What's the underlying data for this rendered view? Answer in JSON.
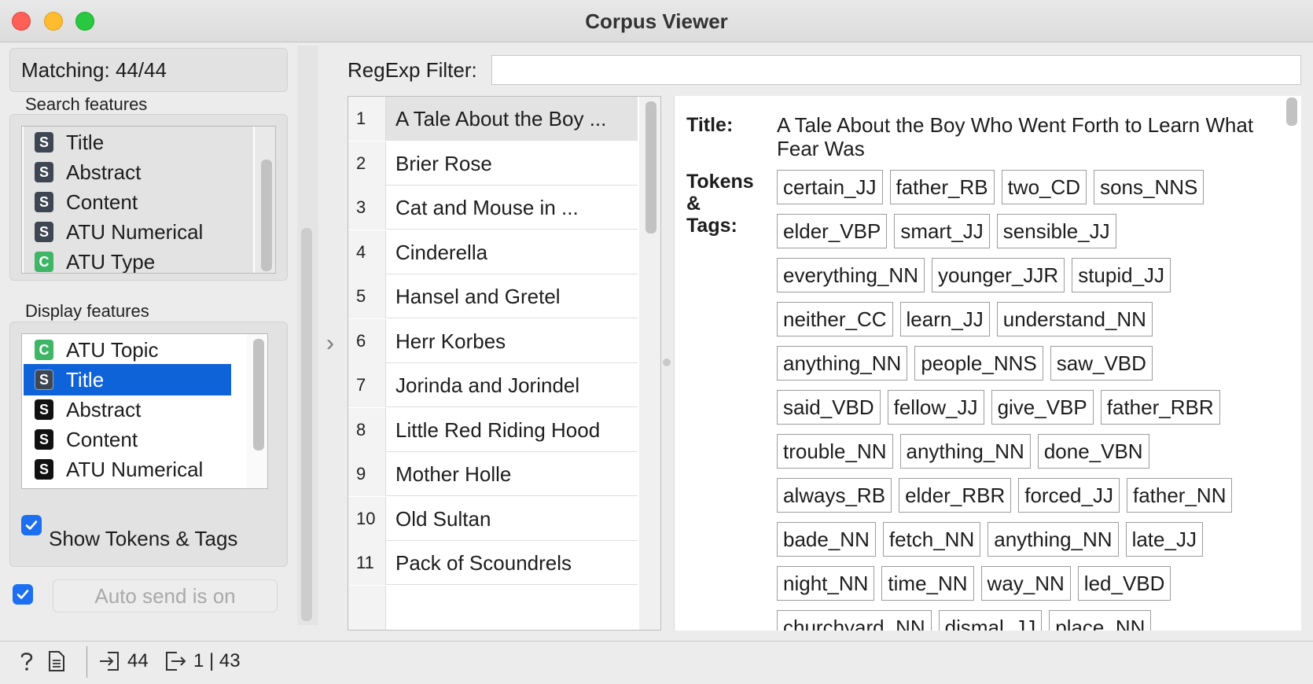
{
  "window": {
    "title": "Corpus Viewer"
  },
  "matching": {
    "label": "Matching: 44/44"
  },
  "search_features": {
    "label": "Search features",
    "items": [
      {
        "badge": "S",
        "label": "Title"
      },
      {
        "badge": "S",
        "label": "Abstract"
      },
      {
        "badge": "S",
        "label": "Content"
      },
      {
        "badge": "S",
        "label": "ATU Numerical"
      },
      {
        "badge": "C",
        "label": "ATU Type"
      }
    ]
  },
  "display_features": {
    "label": "Display features",
    "items": [
      {
        "badge": "C",
        "label": "ATU Topic"
      },
      {
        "badge": "S",
        "label": "Title",
        "selected": true
      },
      {
        "badge": "S",
        "label": "Abstract"
      },
      {
        "badge": "S",
        "label": "Content"
      },
      {
        "badge": "S",
        "label": "ATU Numerical"
      }
    ],
    "show_tokens_label": "Show Tokens & Tags",
    "show_tokens_checked": true
  },
  "auto_send": {
    "label": "Auto send is on",
    "checked": true
  },
  "filter": {
    "label": "RegExp Filter:",
    "value": ""
  },
  "documents": [
    {
      "num": "1",
      "title": "A Tale About the Boy ...",
      "selected": true
    },
    {
      "num": "2",
      "title": "Brier Rose"
    },
    {
      "num": "3",
      "title": "Cat and Mouse in ..."
    },
    {
      "num": "4",
      "title": "Cinderella"
    },
    {
      "num": "5",
      "title": "Hansel and Gretel"
    },
    {
      "num": "6",
      "title": "Herr Korbes"
    },
    {
      "num": "7",
      "title": "Jorinda and Jorindel"
    },
    {
      "num": "8",
      "title": "Little Red Riding Hood"
    },
    {
      "num": "9",
      "title": "Mother Holle"
    },
    {
      "num": "10",
      "title": "Old Sultan"
    },
    {
      "num": "11",
      "title": "Pack of Scoundrels"
    }
  ],
  "detail": {
    "title_label": "Title:",
    "title_value": "A Tale About the Boy Who Went Forth to Learn What Fear Was",
    "tokens_label_1": "Tokens",
    "tokens_label_2": "&",
    "tokens_label_3": "Tags:",
    "tag_rows": [
      [
        "certain_JJ",
        "father_RB",
        "two_CD",
        "sons_NNS"
      ],
      [
        "elder_VBP",
        "smart_JJ",
        "sensible_JJ"
      ],
      [
        "everything_NN",
        "younger_JJR",
        "stupid_JJ"
      ],
      [
        "neither_CC",
        "learn_JJ",
        "understand_NN"
      ],
      [
        "anything_NN",
        "people_NNS",
        "saw_VBD"
      ],
      [
        "said_VBD",
        "fellow_JJ",
        "give_VBP",
        "father_RBR"
      ],
      [
        "trouble_NN",
        "anything_NN",
        "done_VBN"
      ],
      [
        "always_RB",
        "elder_RBR",
        "forced_JJ",
        "father_NN"
      ],
      [
        "bade_NN",
        "fetch_NN",
        "anything_NN",
        "late_JJ"
      ],
      [
        "night_NN",
        "time_NN",
        "way_NN",
        "led_VBD"
      ],
      [
        "churchyard_NN",
        "dismal_JJ",
        "place_NN"
      ]
    ]
  },
  "status": {
    "input_count": "44",
    "output_count": "1 | 43"
  },
  "icons": {
    "help": "help-icon",
    "report": "report-icon",
    "input": "input-signal-icon",
    "output": "output-signal-icon"
  }
}
